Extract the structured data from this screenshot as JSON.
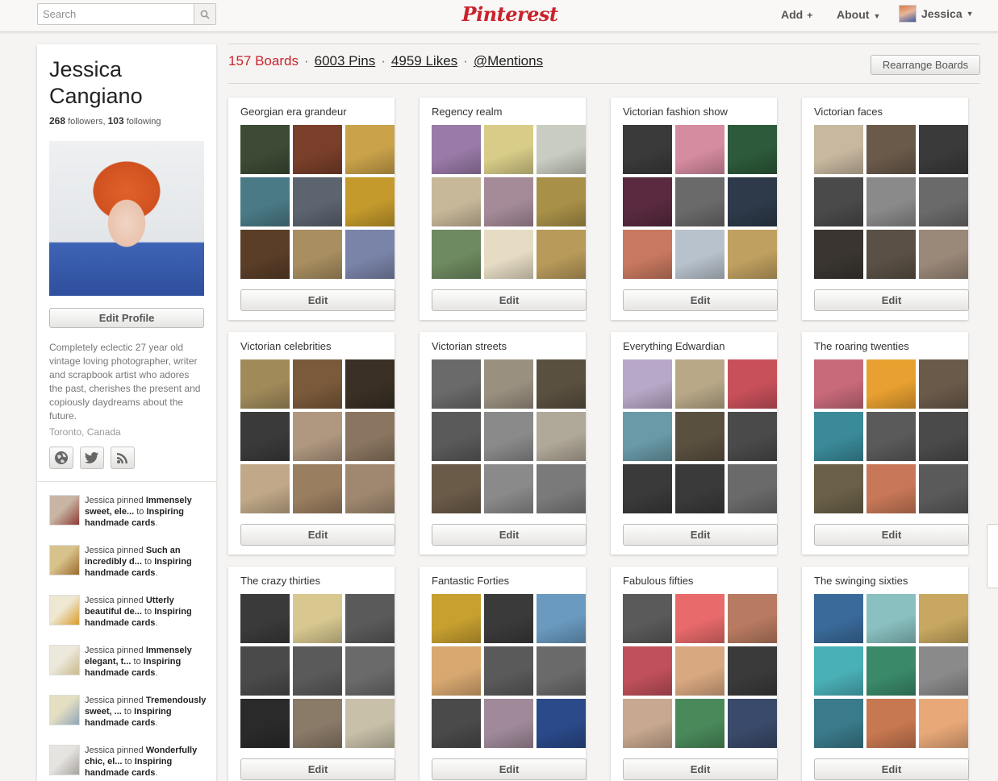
{
  "header": {
    "search_placeholder": "Search",
    "logo": "Pinterest",
    "add_label": "Add",
    "about_label": "About",
    "user_name": "Jessica",
    "brand_color": "#c8232c"
  },
  "profile": {
    "name": "Jessica Cangiano",
    "followers_count": "268",
    "followers_label": "followers,",
    "following_count": "103",
    "following_label": "following",
    "edit_profile_label": "Edit Profile",
    "bio": "Completely eclectic 27 year old vintage loving photographer, writer and scrapbook artist who adores the past, cherishes the present and copiously daydreams about the future.",
    "location": "Toronto, Canada",
    "social": [
      "globe-icon",
      "twitter-icon",
      "rss-icon"
    ]
  },
  "activity": [
    {
      "prefix": "Jessica pinned",
      "title": "Immensely sweet, ele...",
      "to": "to",
      "board": "Inspiring handmade cards",
      "colors": [
        "#c8b5a3",
        "#8b3a35"
      ]
    },
    {
      "prefix": "Jessica pinned",
      "title": "Such an incredibly d...",
      "to": "to",
      "board": "Inspiring handmade cards",
      "colors": [
        "#d8c28b",
        "#9a6a2e"
      ]
    },
    {
      "prefix": "Jessica pinned",
      "title": "Utterly beautiful de...",
      "to": "to",
      "board": "Inspiring handmade cards",
      "colors": [
        "#eee7d2",
        "#d99b2b"
      ]
    },
    {
      "prefix": "Jessica pinned",
      "title": "Immensely elegant, t...",
      "to": "to",
      "board": "Inspiring handmade cards",
      "colors": [
        "#ece8dc",
        "#c9b98c"
      ]
    },
    {
      "prefix": "Jessica pinned",
      "title": "Tremendously sweet, ...",
      "to": "to",
      "board": "Inspiring handmade cards",
      "colors": [
        "#e4dec2",
        "#8fa6b6"
      ]
    },
    {
      "prefix": "Jessica pinned",
      "title": "Wonderfully chic, el...",
      "to": "to",
      "board": "Inspiring handmade cards",
      "colors": [
        "#e6e4e0",
        "#a7a3a0"
      ]
    }
  ],
  "stats": {
    "boards": "157 Boards",
    "pins": "6003 Pins",
    "likes": "4959 Likes",
    "mentions": "@Mentions",
    "separator": "·"
  },
  "rearrange_label": "Rearrange Boards",
  "edit_label": "Edit",
  "boards": [
    {
      "title": "Georgian era grandeur",
      "colors": [
        "#3d4a35",
        "#7a3f2a",
        "#c9a24a",
        "#4a7a86",
        "#5c6470",
        "#c49a2c",
        "#5a3e28",
        "#a88e60",
        "#7a84a8"
      ]
    },
    {
      "title": "Regency realm",
      "colors": [
        "#9a7aa8",
        "#d8cc88",
        "#c9ccc0",
        "#c8b89a",
        "#a58b98",
        "#a89048",
        "#6e8a60",
        "#e6dcc4",
        "#b89a5a"
      ]
    },
    {
      "title": "Victorian fashion show",
      "colors": [
        "#3a3a3a",
        "#d68ca0",
        "#2d5a3a",
        "#5a2a40",
        "#6a6a6a",
        "#2e3a4a",
        "#c87860",
        "#b8c2cc",
        "#c0a060"
      ]
    },
    {
      "title": "Victorian faces",
      "colors": [
        "#c8b8a0",
        "#6a5a4a",
        "#3a3a3a",
        "#4a4a4a",
        "#8a8a8a",
        "#6a6a6a",
        "#3a3530",
        "#5a5045",
        "#9a8878"
      ]
    },
    {
      "title": "Victorian celebrities",
      "colors": [
        "#a08a5a",
        "#7a5a3a",
        "#3a3025",
        "#3a3a3a",
        "#b09880",
        "#8a7560",
        "#c0a888",
        "#9a7e60",
        "#a08870"
      ]
    },
    {
      "title": "Victorian streets",
      "colors": [
        "#6a6a6a",
        "#9a9080",
        "#5a5040",
        "#5a5a5a",
        "#8a8a8a",
        "#b0a898",
        "#6a5a48",
        "#8a8a8a",
        "#7a7a7a"
      ]
    },
    {
      "title": "Everything Edwardian",
      "colors": [
        "#b8a8c8",
        "#b8a888",
        "#c8505a",
        "#6a9aa8",
        "#5a5040",
        "#4a4a4a",
        "#3a3a3a",
        "#3a3a3a",
        "#6a6a6a"
      ]
    },
    {
      "title": "The roaring twenties",
      "colors": [
        "#c86a7a",
        "#e8a030",
        "#6a5a4a",
        "#3a8a9a",
        "#5a5a5a",
        "#4a4a4a",
        "#6a6048",
        "#c87858",
        "#5a5a5a"
      ]
    },
    {
      "title": "The crazy thirties",
      "colors": [
        "#3a3a3a",
        "#d8c890",
        "#5a5a5a",
        "#4a4a4a",
        "#5a5a5a",
        "#6a6a6a",
        "#2a2a2a",
        "#8a7a68",
        "#c8c0a8"
      ]
    },
    {
      "title": "Fantastic Forties",
      "colors": [
        "#c8a030",
        "#3a3a3a",
        "#6a9ac0",
        "#d8a870",
        "#5a5a5a",
        "#6a6a6a",
        "#4a4a4a",
        "#a08a9a",
        "#2a4a8a"
      ]
    },
    {
      "title": "Fabulous fifties",
      "colors": [
        "#5a5a5a",
        "#e86a6a",
        "#b87a60",
        "#c0505a",
        "#d8a880",
        "#3a3a3a",
        "#c8a890",
        "#4a8a5a",
        "#3a4a6a"
      ]
    },
    {
      "title": "The swinging sixties",
      "colors": [
        "#3a6a9a",
        "#8ac0c0",
        "#c8a860",
        "#4ab0b8",
        "#3a8a6a",
        "#8a8a8a",
        "#3a7a8a",
        "#c87850",
        "#e8a878"
      ]
    }
  ]
}
